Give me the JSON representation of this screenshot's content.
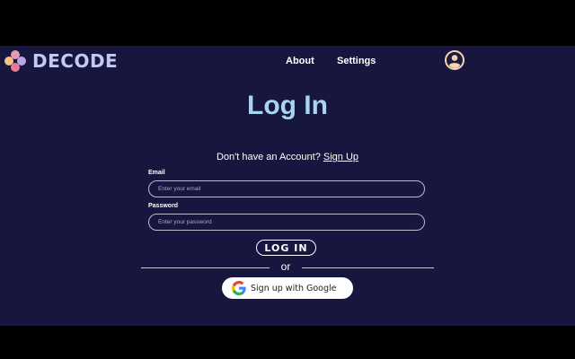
{
  "header": {
    "logo_text": "DECODE",
    "nav": [
      {
        "label": "About"
      },
      {
        "label": "Settings"
      }
    ],
    "avatar_icon": "user-circle-icon"
  },
  "login": {
    "title": "Log In",
    "prompt_text": "Don't have an Account? ",
    "signup_link": "Sign Up",
    "email_label": "Email",
    "email_placeholder": "Enter your email",
    "password_label": "Password",
    "password_placeholder": "Enter your password",
    "login_button": "LOG IN",
    "divider_text": "or",
    "google_button": "Sign up with Google",
    "google_icon": "google-logo-icon"
  },
  "colors": {
    "background": "#17163f",
    "title": "#a9d3ef",
    "logo_text": "#c5c8f2",
    "avatar": "#f6d3b6"
  }
}
